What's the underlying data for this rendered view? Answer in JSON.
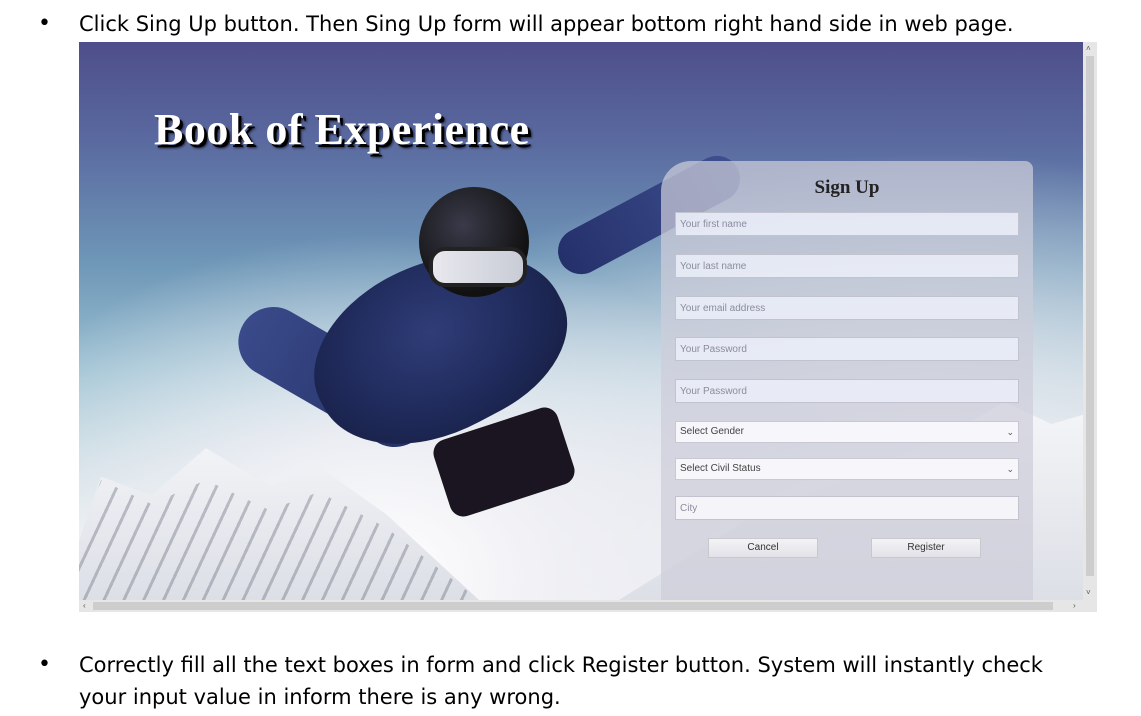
{
  "instructions": {
    "step1": "Click Sing Up button. Then Sing Up form will appear bottom right hand side in web page.",
    "step2": "Correctly fill all the text boxes in form and click Register button. System will instantly check your input value in inform there is any wrong.",
    "bullet": "•"
  },
  "page": {
    "hero_title": "Book of Experience"
  },
  "signup_form": {
    "title": "Sign Up",
    "first_name_placeholder": "Your first name",
    "last_name_placeholder": "Your last name",
    "email_placeholder": "Your email address",
    "password_placeholder": "Your Password",
    "confirm_password_placeholder": "Your Password",
    "gender_select": "Select Gender",
    "civil_status_select": "Select Civil Status",
    "city_placeholder": "City",
    "cancel_label": "Cancel",
    "register_label": "Register"
  },
  "scrollbar": {
    "up": "˄",
    "down": "˅",
    "left": "‹",
    "right": "›"
  },
  "icons": {
    "select_chevron": "chevron-down-icon"
  }
}
